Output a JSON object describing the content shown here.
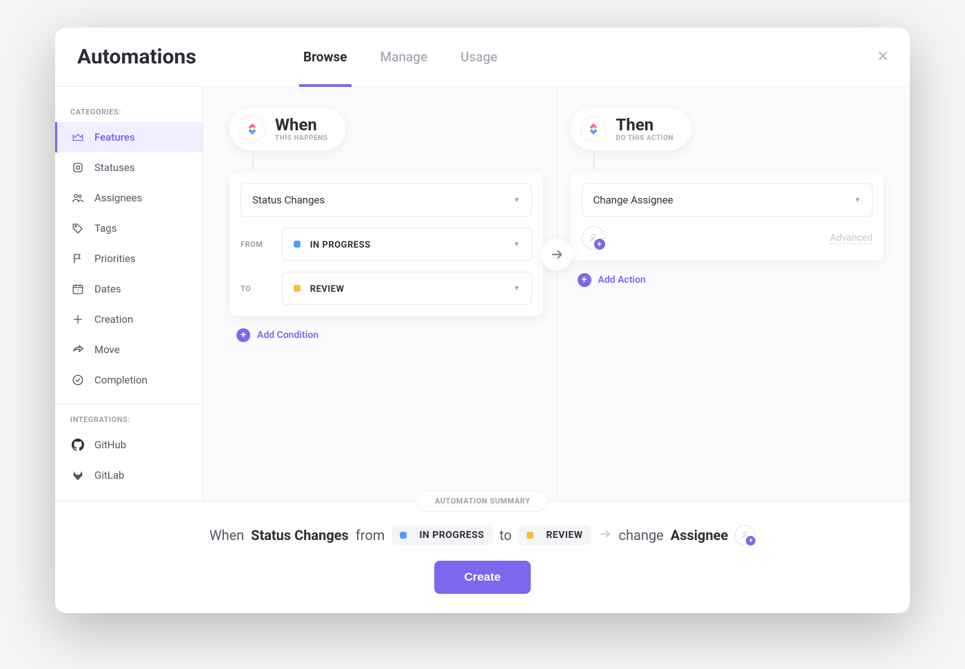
{
  "header": {
    "title": "Automations",
    "tabs": [
      {
        "label": "Browse",
        "active": true
      },
      {
        "label": "Manage",
        "active": false
      },
      {
        "label": "Usage",
        "active": false
      }
    ]
  },
  "sidebar": {
    "categories_label": "CATEGORIES:",
    "items": [
      {
        "label": "Features",
        "icon": "crown-icon",
        "active": true
      },
      {
        "label": "Statuses",
        "icon": "square-icon",
        "active": false
      },
      {
        "label": "Assignees",
        "icon": "people-icon",
        "active": false
      },
      {
        "label": "Tags",
        "icon": "tag-icon",
        "active": false
      },
      {
        "label": "Priorities",
        "icon": "flag-icon",
        "active": false
      },
      {
        "label": "Dates",
        "icon": "calendar-icon",
        "active": false
      },
      {
        "label": "Creation",
        "icon": "plus-outline-icon",
        "active": false
      },
      {
        "label": "Move",
        "icon": "share-icon",
        "active": false
      },
      {
        "label": "Completion",
        "icon": "check-circle-icon",
        "active": false
      }
    ],
    "integrations_label": "INTEGRATIONS:",
    "integrations": [
      {
        "label": "GitHub",
        "icon": "github-icon"
      },
      {
        "label": "GitLab",
        "icon": "gitlab-icon"
      }
    ]
  },
  "when": {
    "title": "When",
    "subtitle": "THIS HAPPENS",
    "trigger_label": "Status Changes",
    "from_label": "FROM",
    "to_label": "TO",
    "from_status": {
      "label": "IN PROGRESS",
      "color": "#4f9cff"
    },
    "to_status": {
      "label": "REVIEW",
      "color": "#f9be33"
    },
    "add_condition_label": "Add Condition"
  },
  "then": {
    "title": "Then",
    "subtitle": "DO THIS ACTION",
    "action_label": "Change Assignee",
    "advanced_label": "Advanced",
    "add_action_label": "Add Action"
  },
  "summary": {
    "chip": "AUTOMATION SUMMARY",
    "word_when": "When",
    "trigger": "Status Changes",
    "word_from": "from",
    "from_status": {
      "label": "IN PROGRESS",
      "color": "#4f9cff"
    },
    "word_to": "to",
    "to_status": {
      "label": "REVIEW",
      "color": "#f9be33"
    },
    "word_change": "change",
    "target": "Assignee",
    "create_button": "Create"
  },
  "colors": {
    "accent": "#7b68ee"
  }
}
